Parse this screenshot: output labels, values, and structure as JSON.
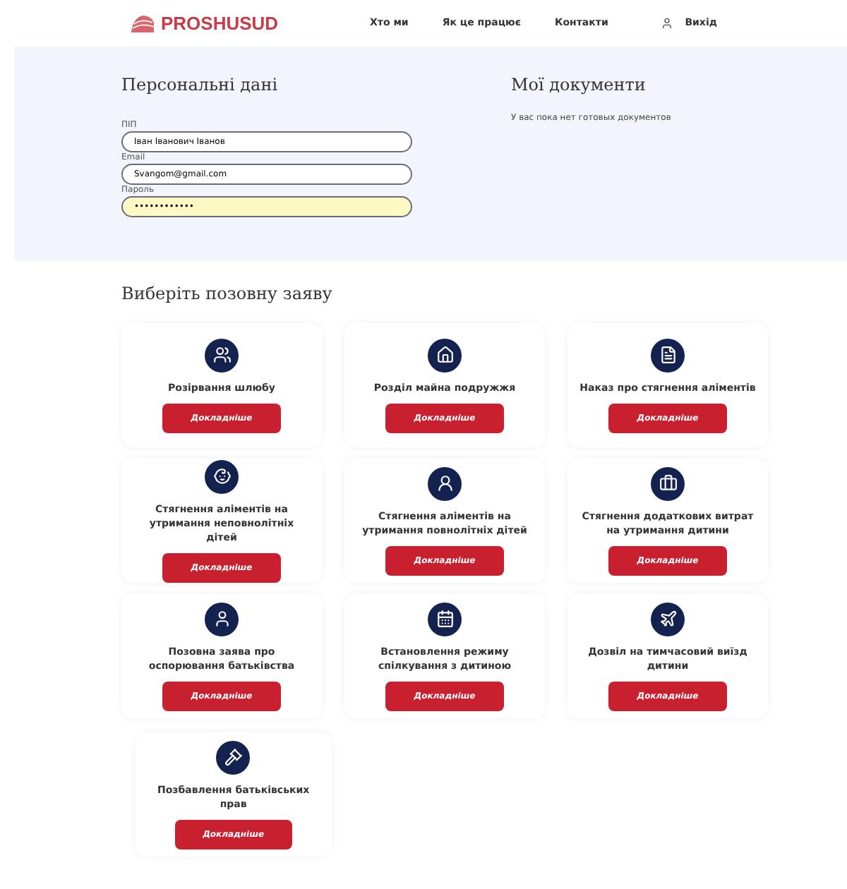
{
  "header": {
    "logo": "PROSHUSUD",
    "nav": [
      "Хто ми",
      "Як це працює",
      "Контакти"
    ],
    "logout": "Вихід"
  },
  "personal": {
    "title": "Персональні дані",
    "fields": [
      {
        "label": "ПІП",
        "value": "Іван Іванович Іванов",
        "highlighted": false
      },
      {
        "label": "Email",
        "value": "Svangom@gmail.com",
        "highlighted": false
      },
      {
        "label": "Пароль",
        "value": "••••••••••••",
        "highlighted": true
      }
    ]
  },
  "documents": {
    "title": "Мої документи",
    "empty_text": "У вас пока нет готовых документов"
  },
  "claims": {
    "title": "Виберіть позовну заяву",
    "cards": [
      {
        "title": "Розірвання шлюбу",
        "button": "Докладніше"
      },
      {
        "title": "Розділ майна подружжя",
        "button": "Докладніше"
      },
      {
        "title": "Наказ про стягнення аліментів",
        "button": "Докладніше"
      },
      {
        "title": "Стягнення аліментів на утримання неповнолітніх дітей",
        "button": "Докладніше"
      },
      {
        "title": "Стягнення аліментів на утримання повнолітніх дітей",
        "button": "Докладніше"
      },
      {
        "title": "Стягнення додаткових витрат на утримання дитини",
        "button": "Докладніше"
      },
      {
        "title": "Позовна заява про оспорювання батьківства",
        "button": "Докладніше"
      },
      {
        "title": "Встановлення режиму спілкування з дитиною",
        "button": "Докладніше"
      },
      {
        "title": "Дозвіл на тимчасовий виїзд дитини",
        "button": "Докладніше"
      },
      {
        "title": "Позбавлення батьківських прав",
        "button": "Докладніше"
      }
    ]
  }
}
